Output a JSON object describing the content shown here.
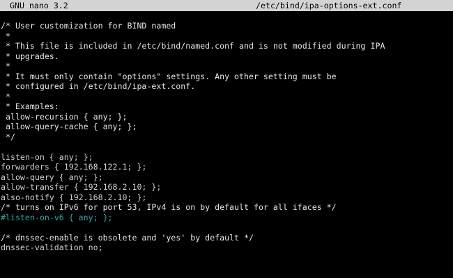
{
  "titlebar": {
    "app_name": "GNU nano 3.2",
    "file_path": "/etc/bind/ipa-options-ext.conf"
  },
  "editor": {
    "lines": [
      {
        "text": "/* User customization for BIND named",
        "kind": "comment"
      },
      {
        "text": " *",
        "kind": "comment"
      },
      {
        "text": " * This file is included in /etc/bind/named.conf and is not modified during IPA",
        "kind": "comment"
      },
      {
        "text": " * upgrades.",
        "kind": "comment"
      },
      {
        "text": " *",
        "kind": "comment"
      },
      {
        "text": " * It must only contain \"options\" settings. Any other setting must be",
        "kind": "comment"
      },
      {
        "text": " * configured in /etc/bind/ipa-ext.conf.",
        "kind": "comment"
      },
      {
        "text": " *",
        "kind": "comment"
      },
      {
        "text": " * Examples:",
        "kind": "comment"
      },
      {
        "text": " allow-recursion { any; };",
        "kind": "comment"
      },
      {
        "text": " allow-query-cache { any; };",
        "kind": "comment"
      },
      {
        "text": " */",
        "kind": "comment"
      },
      {
        "text": "",
        "kind": "code"
      },
      {
        "text": "listen-on { any; };",
        "kind": "code"
      },
      {
        "text": "forwarders { 192.168.122.1; };",
        "kind": "code"
      },
      {
        "text": "allow-query { any; };",
        "kind": "code"
      },
      {
        "text": "allow-transfer { 192.168.2.10; };",
        "kind": "code"
      },
      {
        "text": "also-notify { 192.168.2.10; };",
        "kind": "code"
      },
      {
        "text": "/* turns on IPv6 for port 53, IPv4 is on by default for all ifaces */",
        "kind": "comment"
      },
      {
        "text": "#listen-on-v6 { any; };",
        "kind": "highlight"
      },
      {
        "text": "",
        "kind": "code"
      },
      {
        "text": "/* dnssec-enable is obsolete and 'yes' by default */",
        "kind": "comment"
      },
      {
        "text": "dnssec-validation no;",
        "kind": "code"
      }
    ]
  },
  "colors": {
    "background": "#000000",
    "titlebar_bg": "#d3d3d3",
    "text": "#d0d0d0",
    "highlight": "#2fa8a8"
  }
}
